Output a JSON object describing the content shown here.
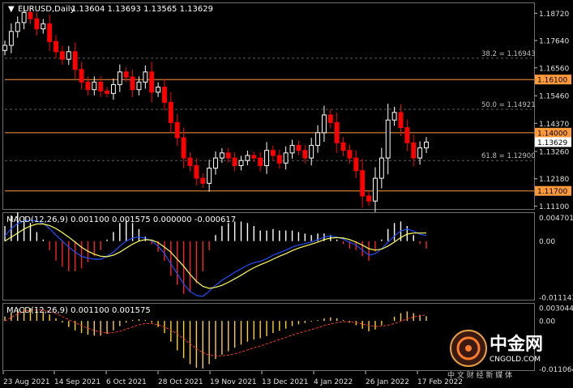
{
  "chart_data": [
    {
      "type": "candlestick",
      "title": "EURUSD,Daily",
      "ohlc_header": "1.13604 1.13693 1.13565 1.13629",
      "ylim": [
        1.1105,
        1.1905
      ],
      "y_ticks": [
        "1.18720",
        "1.17640",
        "1.16560",
        "1.15460",
        "1.14370",
        "1.13260",
        "1.12180",
        "1.11100"
      ],
      "current_price": "1.13629",
      "colors": {
        "up": "#ffffff",
        "down": "#ff0000",
        "grid": "#5c5c5c"
      },
      "horizontal_lines": [
        {
          "label": "1.16100",
          "value": 1.161,
          "color": "#ff9a3c",
          "tag": true
        },
        {
          "label": "1.14000",
          "value": 1.14,
          "color": "#ff9a3c",
          "tag": true
        },
        {
          "label": "1.11700",
          "value": 1.117,
          "color": "#ff9a3c",
          "tag": true
        }
      ],
      "fibonacci": [
        {
          "label": "38.2 = 1.16943",
          "value": 1.16943
        },
        {
          "label": "50.0 = 1.14921",
          "value": 1.14921
        },
        {
          "label": "61.8 = 1.12900",
          "value": 1.129
        }
      ],
      "x_labels": [
        "23 Aug 2021",
        "14 Sep 2021",
        "6 Oct 2021",
        "28 Oct 2021",
        "19 Nov 2021",
        "13 Dec 2021",
        "4 Jan 2022",
        "26 Jan 2022",
        "17 Feb 2022"
      ],
      "series_close_path": [
        1.1745,
        1.18,
        1.1835,
        1.1875,
        1.185,
        1.181,
        1.183,
        1.176,
        1.172,
        1.169,
        1.172,
        1.165,
        1.16,
        1.157,
        1.16,
        1.1565,
        1.1555,
        1.159,
        1.164,
        1.162,
        1.157,
        1.16,
        1.164,
        1.156,
        1.158,
        1.152,
        1.144,
        1.138,
        1.13,
        1.127,
        1.122,
        1.12,
        1.126,
        1.13,
        1.132,
        1.13,
        1.127,
        1.129,
        1.131,
        1.13,
        1.127,
        1.133,
        1.131,
        1.128,
        1.132,
        1.135,
        1.133,
        1.13,
        1.135,
        1.14,
        1.147,
        1.144,
        1.136,
        1.133,
        1.13,
        1.125,
        1.115,
        1.113,
        1.122,
        1.13,
        1.145,
        1.148,
        1.142,
        1.136,
        1.13,
        1.134,
        1.1363
      ]
    },
    {
      "type": "macd",
      "label": "MACD(12,26,9) 0.001100 0.001575 0.000000 -0.000617",
      "ylim": [
        -0.0115,
        0.0051
      ],
      "y_ticks": [
        "0.004701",
        "0.00",
        "-0.011143"
      ],
      "colors": {
        "hist_pos": "#ffffff",
        "hist_neg": "#ff2222",
        "signal": "#ffff55",
        "macd_line": "#1e4fff"
      },
      "macd": [
        0.001,
        0.0025,
        0.0035,
        0.004,
        0.0042,
        0.004,
        0.0035,
        0.0025,
        0.0012,
        0.0,
        -0.0012,
        -0.0022,
        -0.003,
        -0.0034,
        -0.0036,
        -0.0036,
        -0.003,
        -0.0022,
        -0.001,
        0.0,
        0.0006,
        0.0008,
        0.0006,
        0.0,
        -0.001,
        -0.0025,
        -0.0045,
        -0.0065,
        -0.0085,
        -0.01,
        -0.0108,
        -0.011,
        -0.01,
        -0.0088,
        -0.0078,
        -0.007,
        -0.0062,
        -0.0055,
        -0.0048,
        -0.0043,
        -0.004,
        -0.0035,
        -0.0028,
        -0.0023,
        -0.0018,
        -0.0012,
        -0.0008,
        -0.0005,
        -0.0002,
        0.0003,
        0.0008,
        0.001,
        0.0008,
        0.0004,
        -0.0002,
        -0.0008,
        -0.0018,
        -0.0028,
        -0.0025,
        -0.0015,
        -0.0002,
        0.001,
        0.002,
        0.0024,
        0.002,
        0.0014,
        0.0011
      ],
      "signal": [
        0.0,
        0.0008,
        0.0016,
        0.0024,
        0.003,
        0.0034,
        0.0034,
        0.0031,
        0.0025,
        0.0017,
        0.0008,
        -0.0002,
        -0.0012,
        -0.002,
        -0.0026,
        -0.003,
        -0.0031,
        -0.0028,
        -0.0022,
        -0.0014,
        -0.0006,
        0.0,
        0.0003,
        0.0002,
        -0.0003,
        -0.0012,
        -0.0022,
        -0.0036,
        -0.005,
        -0.0066,
        -0.008,
        -0.009,
        -0.0094,
        -0.0092,
        -0.0088,
        -0.0082,
        -0.0075,
        -0.0068,
        -0.006,
        -0.0053,
        -0.0047,
        -0.0042,
        -0.0036,
        -0.003,
        -0.0025,
        -0.0019,
        -0.0014,
        -0.001,
        -0.0006,
        -0.0002,
        0.0003,
        0.0006,
        0.0007,
        0.0006,
        0.0003,
        -0.0002,
        -0.0008,
        -0.0015,
        -0.0018,
        -0.0016,
        -0.001,
        -0.0002,
        0.0007,
        0.0014,
        0.0016,
        0.0016,
        0.0016
      ]
    },
    {
      "type": "macd",
      "label": "MACD(12,26,9) 0.001100 0.001575",
      "ylim": [
        -0.0112,
        0.0034
      ],
      "y_ticks": [
        "0.003044",
        "0.00",
        "-0.011064"
      ],
      "colors": {
        "hist": "#ffd21e",
        "signal": "#ff3a2a"
      },
      "macd": [
        0.001,
        0.002,
        0.0028,
        0.003,
        0.003,
        0.0027,
        0.0022,
        0.0015,
        0.0006,
        -0.0004,
        -0.0014,
        -0.0022,
        -0.0028,
        -0.0032,
        -0.0034,
        -0.0034,
        -0.003,
        -0.0022,
        -0.0012,
        -0.0004,
        0.0002,
        0.0004,
        0.0002,
        -0.0004,
        -0.0014,
        -0.0028,
        -0.0048,
        -0.0068,
        -0.0086,
        -0.01,
        -0.0108,
        -0.011,
        -0.01,
        -0.0088,
        -0.0078,
        -0.007,
        -0.0062,
        -0.0055,
        -0.0048,
        -0.0043,
        -0.004,
        -0.0035,
        -0.0028,
        -0.0023,
        -0.0018,
        -0.0012,
        -0.0008,
        -0.0005,
        -0.0002,
        0.0002,
        0.0006,
        0.0008,
        0.0006,
        0.0002,
        -0.0004,
        -0.001,
        -0.0018,
        -0.0024,
        -0.002,
        -0.001,
        0.0,
        0.001,
        0.0018,
        0.0022,
        0.0018,
        0.0014,
        0.0011
      ],
      "signal": [
        0.0,
        0.0008,
        0.0016,
        0.0022,
        0.0025,
        0.0026,
        0.0025,
        0.0022,
        0.0017,
        0.001,
        0.0003,
        -0.0004,
        -0.0011,
        -0.0017,
        -0.0022,
        -0.0026,
        -0.0028,
        -0.0027,
        -0.0024,
        -0.0019,
        -0.0014,
        -0.0009,
        -0.0006,
        -0.0006,
        -0.0009,
        -0.0014,
        -0.0021,
        -0.003,
        -0.0041,
        -0.0053,
        -0.0064,
        -0.0073,
        -0.0079,
        -0.0081,
        -0.0081,
        -0.0079,
        -0.0076,
        -0.0072,
        -0.0067,
        -0.0062,
        -0.0058,
        -0.0053,
        -0.0048,
        -0.0043,
        -0.0038,
        -0.0033,
        -0.0028,
        -0.0024,
        -0.002,
        -0.0016,
        -0.0011,
        -0.0007,
        -0.0004,
        -0.0002,
        -0.0002,
        -0.0004,
        -0.0007,
        -0.0011,
        -0.0013,
        -0.0012,
        -0.001,
        -0.0006,
        -0.0001,
        0.0005,
        0.0009,
        0.0012,
        0.0014
      ]
    }
  ],
  "watermark": {
    "brand": "中金网",
    "domain": "CNGOLD.COM",
    "tagline": "中 文 财 经 新 媒 体"
  }
}
